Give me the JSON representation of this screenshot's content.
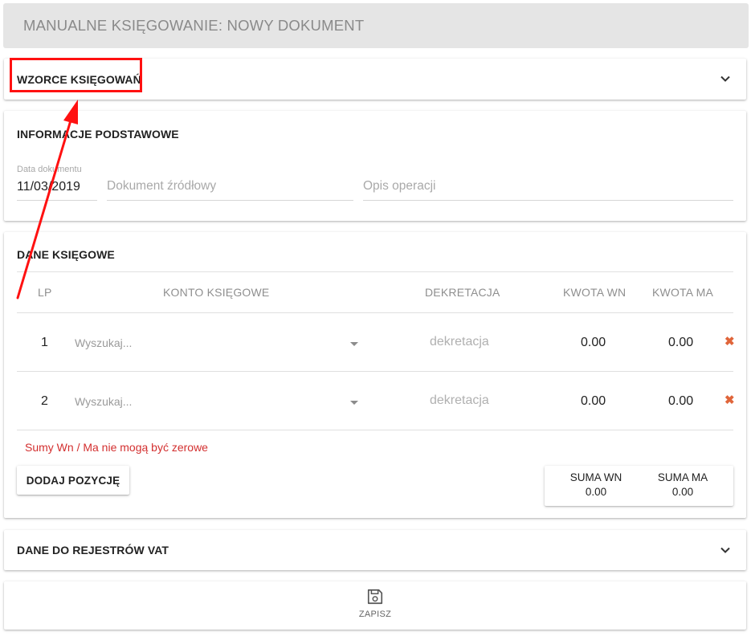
{
  "page_title": "MANUALNE KSIĘGOWANIE: NOWY DOKUMENT",
  "wzorce": {
    "title": "WZORCE KSIĘGOWAŃ"
  },
  "info": {
    "title": "INFORMACJE PODSTAWOWE",
    "date_label": "Data dokumentu",
    "date_value": "11/03/2019",
    "source_doc_placeholder": "Dokument źródłowy",
    "description_placeholder": "Opis operacji"
  },
  "entries": {
    "title": "DANE KSIĘGOWE",
    "columns": [
      "LP",
      "KONTO KSIĘGOWE",
      "DEKRETACJA",
      "KWOTA WN",
      "KWOTA MA"
    ],
    "rows": [
      {
        "lp": "1",
        "account_placeholder": "Wyszukaj...",
        "dekretacja_placeholder": "dekretacja",
        "kwota_wn": "0.00",
        "kwota_ma": "0.00"
      },
      {
        "lp": "2",
        "account_placeholder": "Wyszukaj...",
        "dekretacja_placeholder": "dekretacja",
        "kwota_wn": "0.00",
        "kwota_ma": "0.00"
      }
    ],
    "error_message": "Sumy Wn / Ma nie mogą być zerowe",
    "add_button_label": "DODAJ POZYCJĘ",
    "sum_wn_label": "SUMA WN",
    "sum_wn_value": "0.00",
    "sum_ma_label": "SUMA MA",
    "sum_ma_value": "0.00"
  },
  "vat": {
    "title": "DANE DO REJESTRÓW VAT"
  },
  "save": {
    "label": "ZAPISZ"
  },
  "colors": {
    "annotation": "#ff1111",
    "error": "#d32f2f",
    "delete_icon": "#e0653a"
  },
  "icons": [
    "chevron-down-icon",
    "caret-down-icon",
    "delete-x-icon",
    "floppy-disk-icon"
  ]
}
